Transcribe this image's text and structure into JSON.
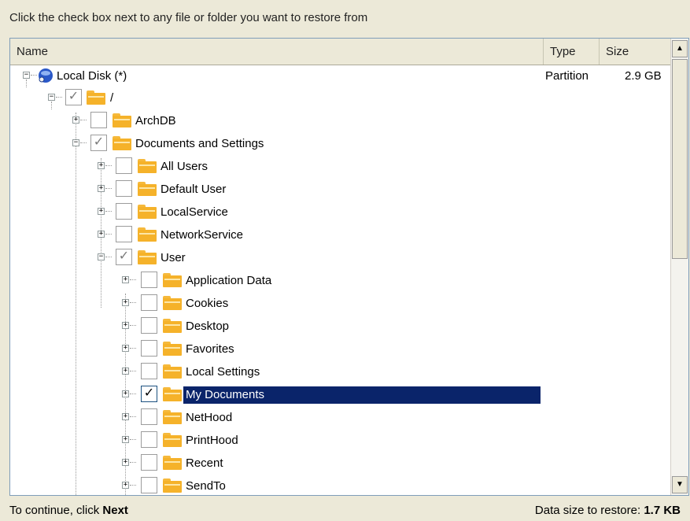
{
  "instruction": "Click the check box next to any file or folder you want to restore from",
  "columns": {
    "name": "Name",
    "type": "Type",
    "size": "Size"
  },
  "icons": {
    "expander_collapse": "−",
    "expander_expand": "+",
    "check": "✓",
    "scroll_up": "▲",
    "scroll_down": "▼"
  },
  "tree": [
    {
      "label": "Local Disk (*)",
      "type": "Partition",
      "size": "2.9 GB"
    },
    {
      "label": "/"
    },
    {
      "label": "ArchDB"
    },
    {
      "label": "Documents and Settings"
    },
    {
      "label": "All Users"
    },
    {
      "label": "Default User"
    },
    {
      "label": "LocalService"
    },
    {
      "label": "NetworkService"
    },
    {
      "label": "User"
    },
    {
      "label": "Application Data"
    },
    {
      "label": "Cookies"
    },
    {
      "label": "Desktop"
    },
    {
      "label": "Favorites"
    },
    {
      "label": "Local Settings"
    },
    {
      "label": "My Documents"
    },
    {
      "label": "NetHood"
    },
    {
      "label": "PrintHood"
    },
    {
      "label": "Recent"
    },
    {
      "label": "SendTo"
    }
  ],
  "footer": {
    "continue_prefix": "To continue, click ",
    "continue_action": "Next",
    "size_prefix": "Data size to restore: ",
    "size_value": "1.7 KB"
  },
  "colors": {
    "selection": "#0a246a",
    "folder": "#f5b22a",
    "window_bg": "#ece9d8"
  }
}
